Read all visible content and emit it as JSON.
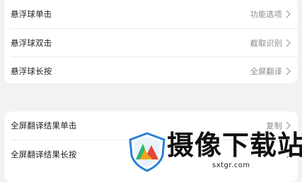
{
  "group1": {
    "items": [
      {
        "label": "悬浮球单击",
        "value": "功能选项"
      },
      {
        "label": "悬浮球双击",
        "value": "截取识别"
      },
      {
        "label": "悬浮球长按",
        "value": "全屏翻译"
      }
    ]
  },
  "group2": {
    "items": [
      {
        "label": "全屏翻译结果单击",
        "value": "复制"
      },
      {
        "label": "全屏翻译结果长按",
        "value": ""
      }
    ]
  },
  "watermark": {
    "text": "摄像下载站",
    "url": "sxtgr.com"
  },
  "colors": {
    "background": "#f2f2f5",
    "card": "#ffffff",
    "label": "#1f1f1f",
    "value": "#8a8a8a"
  }
}
